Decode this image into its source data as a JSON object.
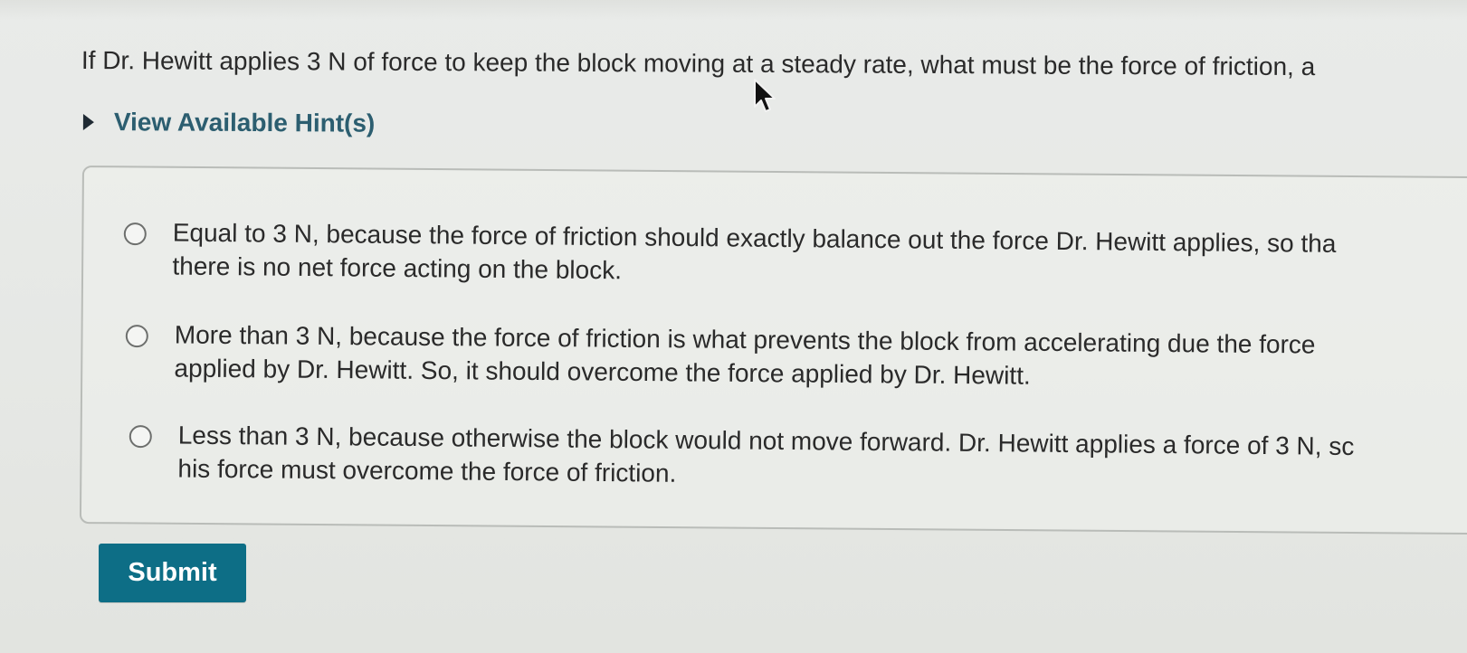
{
  "question": {
    "text": "If Dr. Hewitt applies 3 N of force to keep the block moving at a steady rate, what must be the force of friction, a"
  },
  "hint": {
    "label": "View Available Hint(s)",
    "icon": "triangle-right-icon"
  },
  "answers": [
    {
      "line1": "Equal to 3 N, because the force of friction should exactly balance out the force Dr. Hewitt applies, so tha",
      "line2": "there is no net force acting on the block.",
      "selected": false
    },
    {
      "line1": "More than 3 N, because the force of friction is what prevents the block from accelerating due the force",
      "line2": "applied by Dr. Hewitt. So, it should overcome the force applied by Dr. Hewitt.",
      "selected": false
    },
    {
      "line1": "Less than 3 N, because otherwise the block would not move forward. Dr. Hewitt applies a force of 3 N, sc",
      "line2": "his force must overcome the force of friction.",
      "selected": false
    }
  ],
  "submit": {
    "label": "Submit"
  },
  "colors": {
    "accent": "#0d6e86",
    "hint_text": "#2c5e70",
    "background": "#e7e9e6"
  }
}
